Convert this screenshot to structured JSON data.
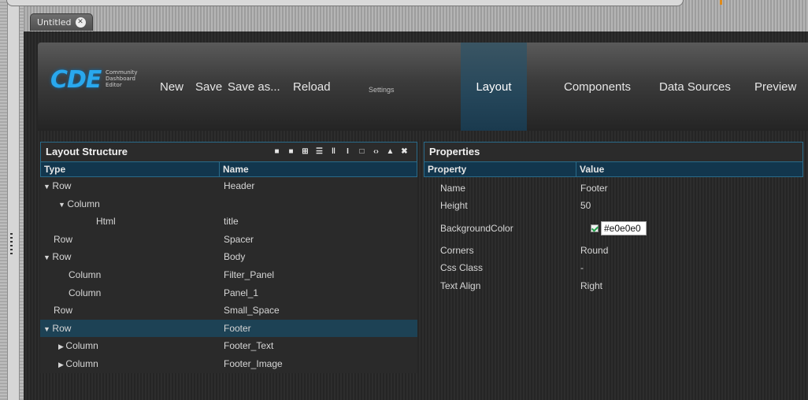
{
  "window": {
    "tab_title": "Untitled"
  },
  "header": {
    "logo_text": "CDE",
    "logo_subtitle": "Community Dashboard Editor",
    "nav": {
      "new": "New",
      "save": "Save",
      "save_as": "Save as...",
      "reload": "Reload",
      "settings": "Settings"
    },
    "modes": {
      "layout": "Layout",
      "components": "Components",
      "data_sources": "Data Sources",
      "preview": "Preview"
    },
    "active_mode": "Layout"
  },
  "layout_structure": {
    "title": "Layout Structure",
    "columns": {
      "type": "Type",
      "name": "Name"
    },
    "toolbar_icons": [
      "save-template-icon",
      "apply-template-icon",
      "add-row-icon",
      "add-rows-icon",
      "add-columns-icon",
      "add-space-icon",
      "add-image-icon",
      "add-html-icon",
      "move-up-icon",
      "delete-icon"
    ],
    "rows": [
      {
        "arrow": "▼",
        "type": "Row",
        "name": "Header",
        "indent": 0
      },
      {
        "arrow": "▼",
        "type": "Column",
        "name": "",
        "indent": 1
      },
      {
        "arrow": "",
        "type": "Html",
        "name": "title",
        "indent": 2
      },
      {
        "arrow": "",
        "type": "Row",
        "name": "Spacer",
        "indent": 0
      },
      {
        "arrow": "▼",
        "type": "Row",
        "name": "Body",
        "indent": 0
      },
      {
        "arrow": "",
        "type": "Column",
        "name": "Filter_Panel",
        "indent": 1
      },
      {
        "arrow": "",
        "type": "Column",
        "name": "Panel_1",
        "indent": 1
      },
      {
        "arrow": "",
        "type": "Row",
        "name": "Small_Space",
        "indent": 0
      },
      {
        "arrow": "▼",
        "type": "Row",
        "name": "Footer",
        "indent": 0,
        "selected": true
      },
      {
        "arrow": "▶",
        "type": "Column",
        "name": "Footer_Text",
        "indent": 1
      },
      {
        "arrow": "▶",
        "type": "Column",
        "name": "Footer_Image",
        "indent": 1
      }
    ]
  },
  "properties": {
    "title": "Properties",
    "columns": {
      "property": "Property",
      "value": "Value"
    },
    "rows": [
      {
        "property": "Name",
        "value": "Footer"
      },
      {
        "property": "Height",
        "value": "50"
      },
      {
        "property": "BackgroundColor",
        "value": "#e0e0e0",
        "kind": "color"
      },
      {
        "property": "Corners",
        "value": "Round"
      },
      {
        "property": "Css Class",
        "value": "-"
      },
      {
        "property": "Text Align",
        "value": "Right"
      }
    ]
  },
  "colors": {
    "accent": "#2a6b8a",
    "header_selected": "#12364d",
    "row_selected": "#1d4255",
    "logo": "#29a8ee"
  }
}
